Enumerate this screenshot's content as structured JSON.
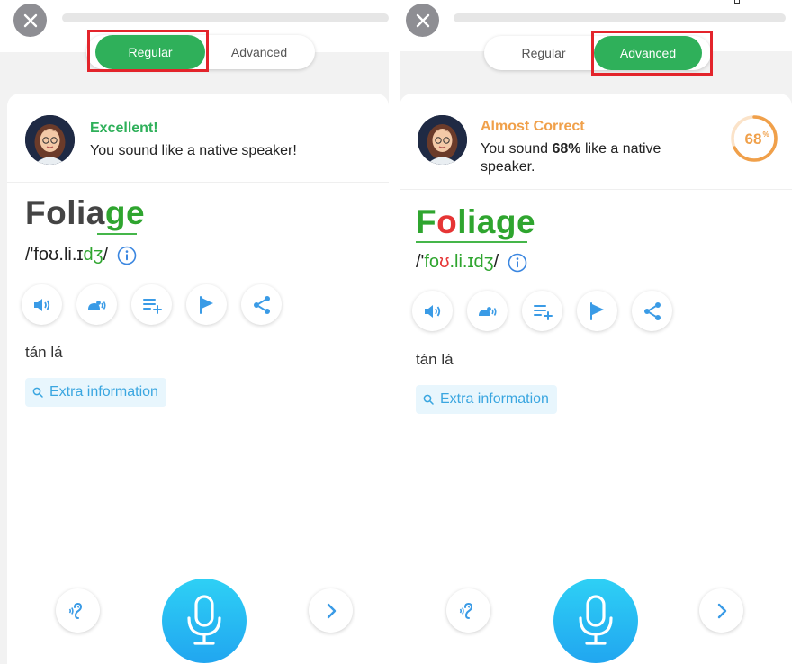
{
  "colors": {
    "accent_green": "#2fb05a",
    "word_green": "#2fa52f",
    "error_red": "#e63535",
    "almost_orange": "#f0a04a",
    "highlight_red": "#e3242b",
    "mic_blue": "#21a6f0",
    "link_blue": "#3aa6e0"
  },
  "left": {
    "mode_toggle": {
      "regular_label": "Regular",
      "advanced_label": "Advanced",
      "selected": "Regular"
    },
    "feedback": {
      "title": "Excellent!",
      "text": "You sound like a native speaker!"
    },
    "word": {
      "plain": "Folia",
      "highlight": "ge"
    },
    "ipa": {
      "open": "/'foʊ.li.ɪ",
      "highlight": "dʒ",
      "close": "/"
    },
    "meaning": "tán lá",
    "extra_label": "Extra information",
    "icons": [
      "close-icon",
      "speaker-icon",
      "slow-speaker-icon",
      "add-to-list-icon",
      "flag-icon",
      "share-icon",
      "info-icon",
      "search-icon",
      "ear-icon",
      "microphone-icon",
      "chevron-right-icon"
    ]
  },
  "right": {
    "mode_toggle": {
      "regular_label": "Regular",
      "advanced_label": "Advanced",
      "selected": "Advanced"
    },
    "feedback": {
      "title": "Almost Correct",
      "text_pre": "You sound ",
      "text_bold": "68%",
      "text_post": " like a native speaker."
    },
    "score": {
      "value": "68",
      "unit": "%",
      "fraction": 0.68
    },
    "word": {
      "p1": "F",
      "p2": "o",
      "p3": "liage"
    },
    "ipa": {
      "p0": "/'",
      "p1": "fo",
      "p2": "ʊ",
      "p3": ".li.ɪdʒ",
      "close": "/"
    },
    "meaning": "tán lá",
    "extra_label": "Extra information"
  }
}
